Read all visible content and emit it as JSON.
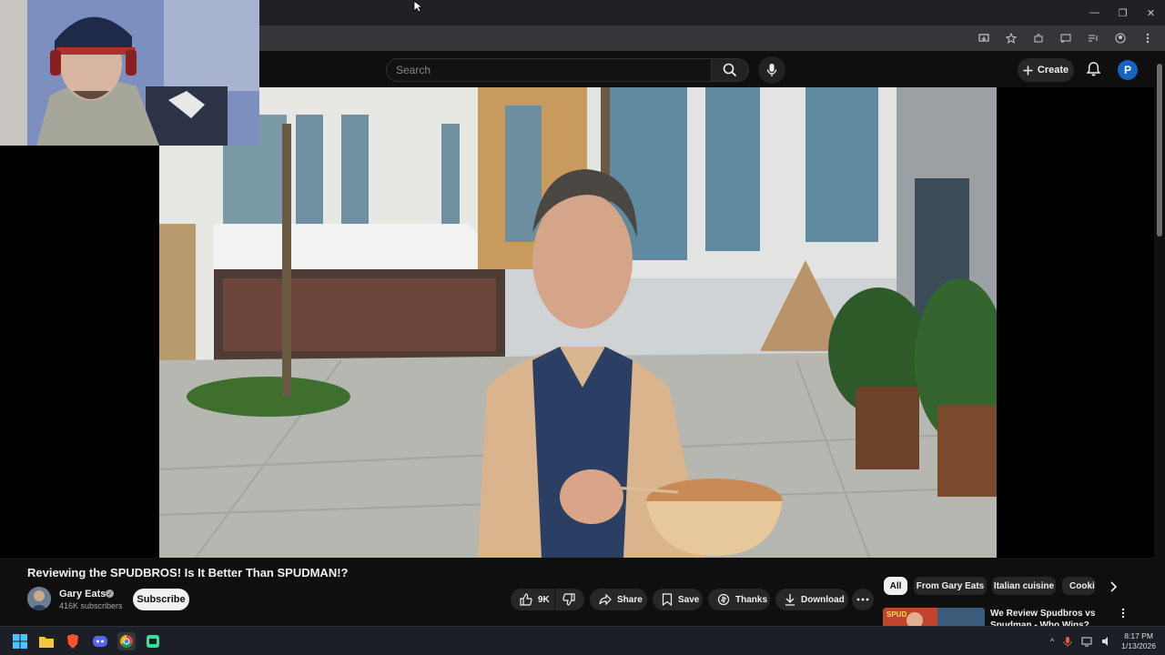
{
  "browser": {
    "window_controls": {
      "minimize": "—",
      "restore": "❐",
      "close": "✕"
    }
  },
  "header": {
    "search_placeholder": "Search",
    "create_label": "Create",
    "account_initial": "P"
  },
  "video": {
    "title": "Reviewing the SPUDBROS! Is It Better Than SPUDMAN!?"
  },
  "channel": {
    "name": "Gary Eats",
    "subscribers": "416K subscribers",
    "subscribe_label": "Subscribe"
  },
  "actions": {
    "like_count": "9K",
    "share_label": "Share",
    "save_label": "Save",
    "thanks_label": "Thanks",
    "download_label": "Download"
  },
  "chips": [
    "All",
    "From Gary Eats",
    "Italian cuisine",
    "Cooki"
  ],
  "recommended": {
    "title": "We Review Spudbros vs Spudman - Who Wins?",
    "thumb_text": "SPUD"
  },
  "taskbar": {
    "time": "8:17 PM",
    "date": "1/13/2026"
  },
  "colors": {
    "background": "#0f0f0f",
    "accent_avatar": "#1565c0",
    "pill": "#272727"
  }
}
